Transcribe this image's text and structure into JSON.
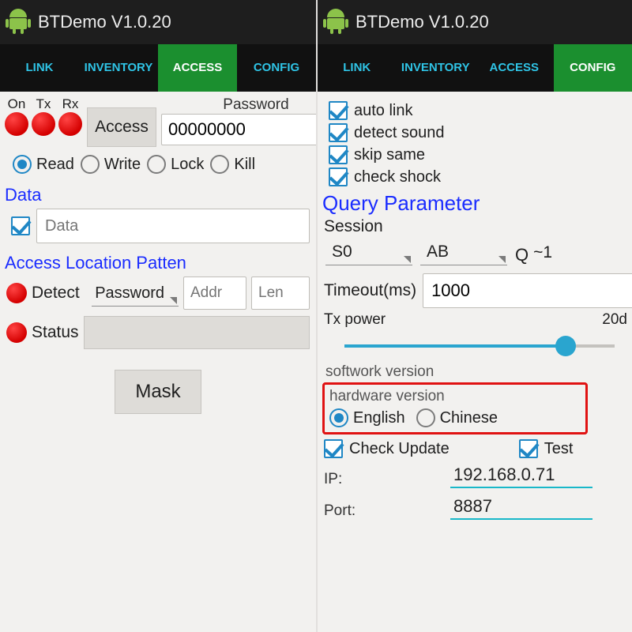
{
  "app": {
    "title": "BTDemo V1.0.20"
  },
  "tabs": {
    "link": "LINK",
    "inventory": "INVENTORY",
    "access": "ACCESS",
    "config": "CONFIG"
  },
  "left": {
    "indicators": {
      "on": "On",
      "tx": "Tx",
      "rx": "Rx"
    },
    "access_btn": "Access",
    "pwd_label": "Password",
    "pwd_value": "00000000",
    "ops": {
      "read": "Read",
      "write": "Write",
      "lock": "Lock",
      "kill": "Kill"
    },
    "data_section": "Data",
    "data_placeholder": "Data",
    "alp_section": "Access Location Patten",
    "detect": "Detect",
    "bank_label": "Password",
    "addr_placeholder": "Addr",
    "len_placeholder": "Len",
    "status": "Status",
    "mask_btn": "Mask"
  },
  "right": {
    "chk": {
      "auto_link": "auto link",
      "detect_sound": "detect sound",
      "skip_same": "skip same",
      "check_shock": "check shock"
    },
    "qp_header": "Query Parameter",
    "session_label": "Session",
    "session_value": "S0",
    "target_value": "AB",
    "q_label": "Q",
    "q_value": "~1",
    "timeout_label": "Timeout(ms)",
    "timeout_value": "1000",
    "tx_power_label": "Tx power",
    "tx_power_value": "20d",
    "softwork": "softwork version",
    "hardware": "hardware version",
    "lang": {
      "en": "English",
      "cn": "Chinese"
    },
    "check_update": "Check Update",
    "test": "Test",
    "ip_label": "IP:",
    "ip_value": "192.168.0.71",
    "port_label": "Port:",
    "port_value": "8887"
  }
}
